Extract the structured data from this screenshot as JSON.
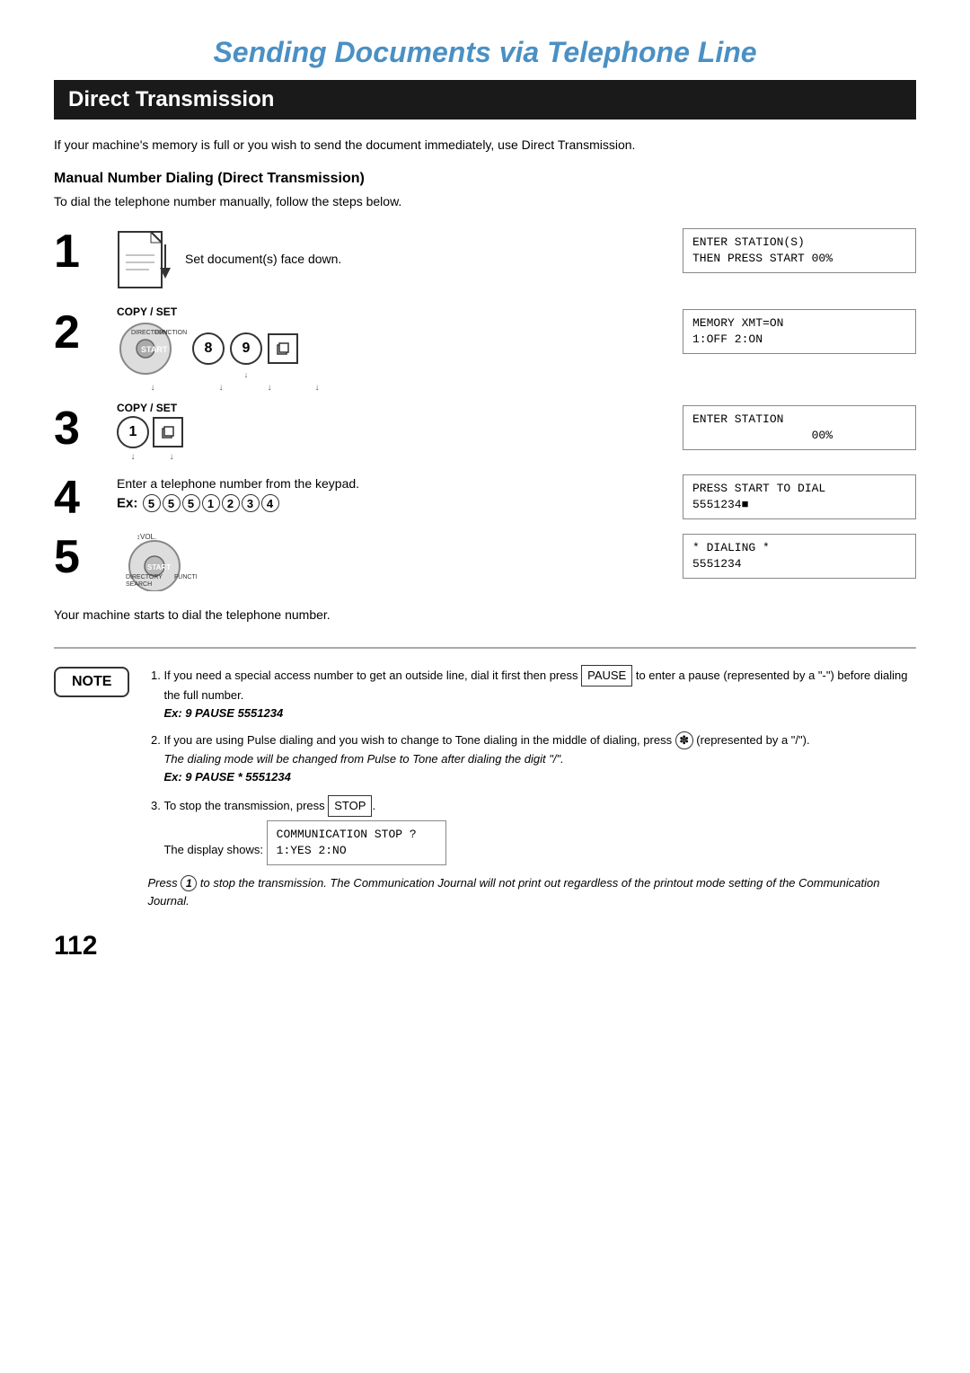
{
  "page": {
    "title": "Sending Documents via Telephone Line",
    "section": "Direct Transmission",
    "intro": "If your machine's memory is full or you wish to send the document immediately, use Direct Transmission.",
    "subsection_title": "Manual Number Dialing (Direct Transmission)",
    "subsection_desc": "To dial the telephone number manually, follow the steps below.",
    "steps": [
      {
        "number": "1",
        "desc": "Set document(s) face down.",
        "lcd_line1": "ENTER STATION(S)",
        "lcd_line2": "THEN PRESS START 00%"
      },
      {
        "number": "2",
        "lcd_line1": "MEMORY XMT=ON",
        "lcd_line2": "1:OFF 2:ON",
        "copy_set_label": "COPY / SET",
        "keys": [
          "8",
          "9"
        ]
      },
      {
        "number": "3",
        "lcd_line1": "ENTER STATION",
        "lcd_line2": "                 00%",
        "copy_set_label": "COPY / SET",
        "keys": [
          "1"
        ]
      },
      {
        "number": "4",
        "desc": "Enter a telephone number from the keypad.",
        "ex_label": "Ex:",
        "ex_digits": [
          "5",
          "5",
          "5",
          "1",
          "2",
          "3",
          "4"
        ],
        "lcd_line1": "PRESS START TO DIAL",
        "lcd_line2": "5551234■"
      },
      {
        "number": "5",
        "lcd_line1": "* DIALING *",
        "lcd_line2": "5551234"
      }
    ],
    "step5_desc": "Your machine starts to dial the telephone number.",
    "note_label": "NOTE",
    "notes": [
      {
        "text_before": "If you need a special access number to get an outside line, dial it first then press ",
        "pause_btn": "PAUSE",
        "text_after": " to enter a pause (represented by a \"-\") before dialing the full number.",
        "bold_ex": "Ex: 9 PAUSE 5551234"
      },
      {
        "text_before": "If you are using Pulse dialing and you wish to change to Tone dialing in the middle of dialing, press ",
        "star_symbol": "✽",
        "text_mid": " (represented by a \"/\").",
        "italic_line1": "The dialing mode will be changed from Pulse to Tone after dialing the digit \"/\".",
        "bold_ex": "Ex: 9 PAUSE * 5551234"
      },
      {
        "text_before": "To stop the transmission, press ",
        "stop_btn": "STOP",
        "text_after": ".",
        "display_shows": "The display shows:",
        "lcd_line1": "COMMUNICATION STOP ?",
        "lcd_line2": "1:YES 2:NO"
      }
    ],
    "bottom_note": "Press ① to stop the transmission. The Communication Journal will not print out regardless of the printout mode setting of the Communication Journal.",
    "page_number": "112"
  }
}
